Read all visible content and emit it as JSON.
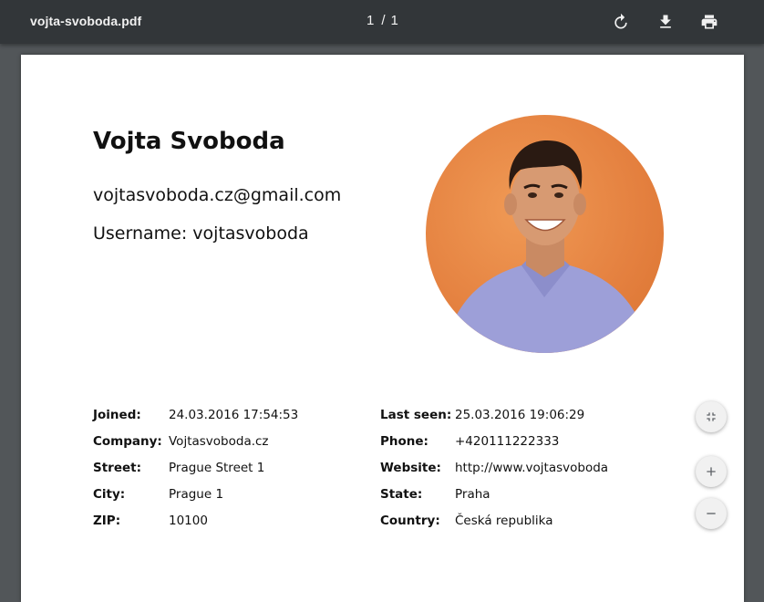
{
  "toolbar": {
    "filename": "vojta-svoboda.pdf",
    "current_page": "1",
    "separator": "/",
    "total_pages": "1",
    "icons": [
      "rotate-icon",
      "download-icon",
      "print-icon"
    ]
  },
  "document": {
    "name": "Vojta Svoboda",
    "email": "vojtasvoboda.cz@gmail.com",
    "username_line": "Username: vojtasvoboda",
    "left_details": [
      {
        "label": "Joined:",
        "value": "24.03.2016 17:54:53"
      },
      {
        "label": "Company:",
        "value": "Vojtasvoboda.cz"
      },
      {
        "label": "Street:",
        "value": "Prague Street 1"
      },
      {
        "label": "City:",
        "value": "Prague 1"
      },
      {
        "label": "ZIP:",
        "value": "10100"
      }
    ],
    "right_details": [
      {
        "label": "Last seen:",
        "value": "25.03.2016 19:06:29"
      },
      {
        "label": "Phone:",
        "value": "+420111222333"
      },
      {
        "label": "Website:",
        "value": "http://www.vojtasvoboda"
      },
      {
        "label": "State:",
        "value": "Praha"
      },
      {
        "label": "Country:",
        "value": "Česká republika"
      }
    ]
  },
  "controls": {
    "icons": [
      "fit-page-icon",
      "zoom-in-icon",
      "zoom-out-icon"
    ]
  },
  "colors": {
    "toolbar_bg": "#323639",
    "viewer_bg": "#525659",
    "avatar_bg": "#e4803f",
    "shirt": "#9d9fd8"
  }
}
